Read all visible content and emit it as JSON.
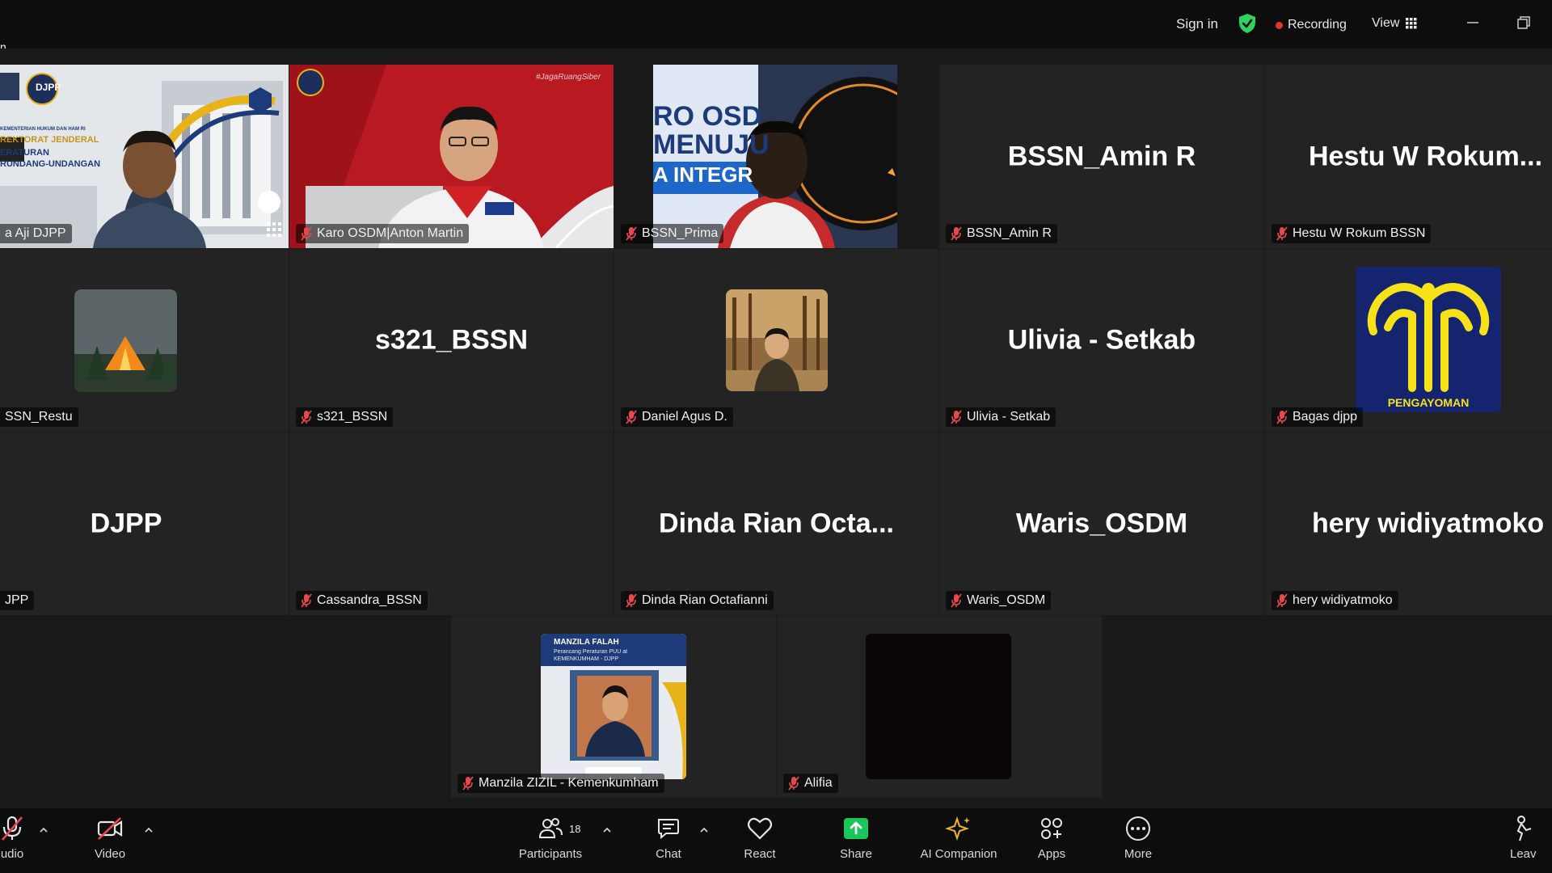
{
  "app": {
    "title_line1": "n",
    "title_line2": "kplace"
  },
  "topbar": {
    "sign_in": "Sign in",
    "recording": "Recording",
    "view": "View"
  },
  "participants": [
    {
      "display": "",
      "label": "a Aji DJPP"
    },
    {
      "display": "",
      "label": "Karo OSDM|Anton Martin"
    },
    {
      "display": "",
      "label": "BSSN_Prima"
    },
    {
      "display": "BSSN_Amin R",
      "label": "BSSN_Amin R"
    },
    {
      "display": "Hestu  W  Rokum...",
      "label": "Hestu W Rokum BSSN"
    },
    {
      "display": "",
      "label": "SSN_Restu"
    },
    {
      "display": "s321_BSSN",
      "label": "s321_BSSN"
    },
    {
      "display": "",
      "label": "Daniel Agus D."
    },
    {
      "display": "Ulivia - Setkab",
      "label": "Ulivia - Setkab"
    },
    {
      "display": "",
      "label": "Bagas djpp"
    },
    {
      "display": "DJPP",
      "label": "JPP"
    },
    {
      "display": "",
      "label": "Cassandra_BSSN"
    },
    {
      "display": "Dinda  Rian  Octa...",
      "label": "Dinda Rian Octafianni"
    },
    {
      "display": "Waris_OSDM",
      "label": "Waris_OSDM"
    },
    {
      "display": "hery widiyatmoko",
      "label": "hery widiyatmoko"
    },
    {
      "display": "",
      "label": "Manzila ZIZIL - Kemenkumham"
    },
    {
      "display": "",
      "label": "Alifia"
    }
  ],
  "slides": {
    "djpp_banner_1": "KEMENTERIAN HUKUM DAN HAM RI",
    "djpp_banner_2": "REKTORAT JENDERAL",
    "djpp_banner_3": "ERATURAN",
    "djpp_banner_4": "RUNDANG-UNDANGAN",
    "djpp_logo": "DJPP",
    "hashtag": "#JagaRuangSiber",
    "prima_bg_1": "RO OSD",
    "prima_bg_2": "MENUJU",
    "prima_bg_3": "A INTEGR",
    "pengayoman": "PENGAYOMAN",
    "manzila_1": "MANZILA FALAH",
    "manzila_2": "Perancang Peraturan PUU at",
    "manzila_3": "KEMENKUMHAM - DJPP"
  },
  "toolbar": {
    "audio": "udio",
    "video": "Video",
    "participants": "Participants",
    "participants_count": "18",
    "chat": "Chat",
    "react": "React",
    "share": "Share",
    "ai": "AI Companion",
    "apps": "Apps",
    "more": "More",
    "leave": "Leav"
  },
  "colors": {
    "accent_green": "#3fd46a",
    "share_green": "#19c65a",
    "record_red": "#e8322b",
    "mic_red": "#e5484d",
    "pengayoman_bg": "#14246e",
    "pengayoman_fg": "#f7e21a"
  }
}
